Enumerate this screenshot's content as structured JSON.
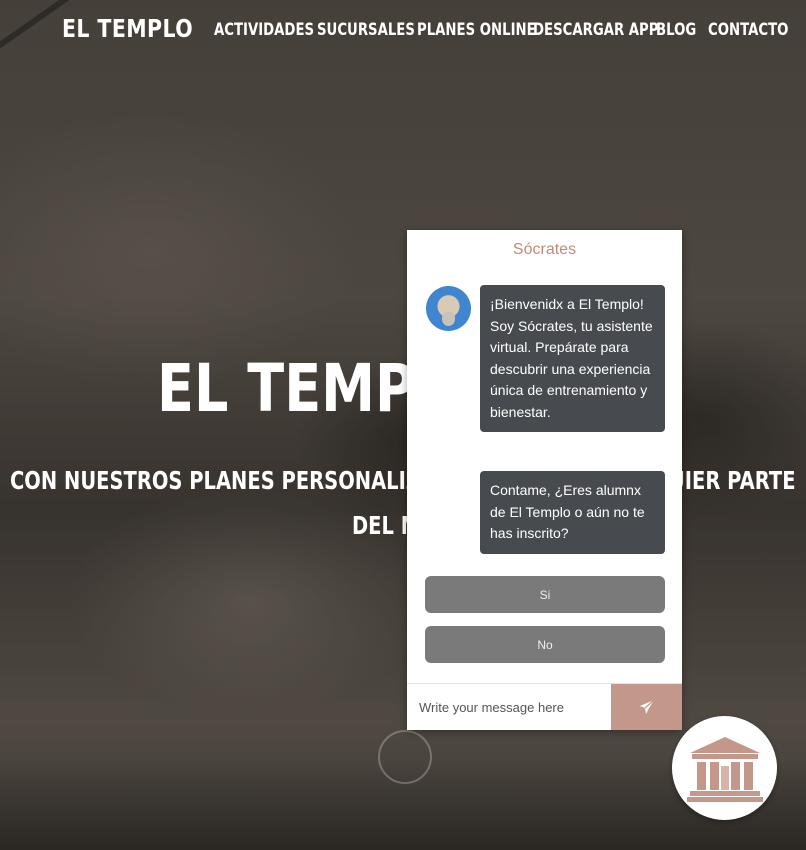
{
  "brand": {
    "logo_text": "EL TEMPLO"
  },
  "nav": {
    "items": [
      {
        "label": "ACTIVIDADES"
      },
      {
        "label": "SUCURSALES"
      },
      {
        "label": "PLANES ONLINE"
      },
      {
        "label": "DESCARGAR APP"
      },
      {
        "label": "BLOG"
      },
      {
        "label": "CONTACTO"
      }
    ]
  },
  "hero": {
    "title_visible": "EL TEMPLO E",
    "subtitle_line1_left": "CON NUESTROS PLANES PERSONALIZADOS PO",
    "subtitle_line1_right": "QUIER PARTE",
    "subtitle_line2": "DEL MU"
  },
  "chat": {
    "header_title": "Sócrates",
    "messages": [
      {
        "text": "¡Bienvenidx a El Templo! Soy Sócrates, tu asistente virtual. Prepárate para descubrir una experiencia única de entrenamiento y bienestar."
      },
      {
        "text": "Contame, ¿Eres alumnx de El Templo o aún no te has inscrito?"
      }
    ],
    "options": [
      {
        "label": "Si"
      },
      {
        "label": "No"
      }
    ],
    "input": {
      "placeholder": "Write your message here",
      "value": ""
    },
    "send_icon": "paper-plane-icon",
    "avatar_icon": "socrates-avatar-icon"
  },
  "launcher": {
    "icon": "temple-icon"
  },
  "colors": {
    "chat_accent": "#c3978a",
    "header_title": "#c08a78",
    "bubble_bg": "#474b50",
    "option_bg": "#7a7a7a"
  }
}
